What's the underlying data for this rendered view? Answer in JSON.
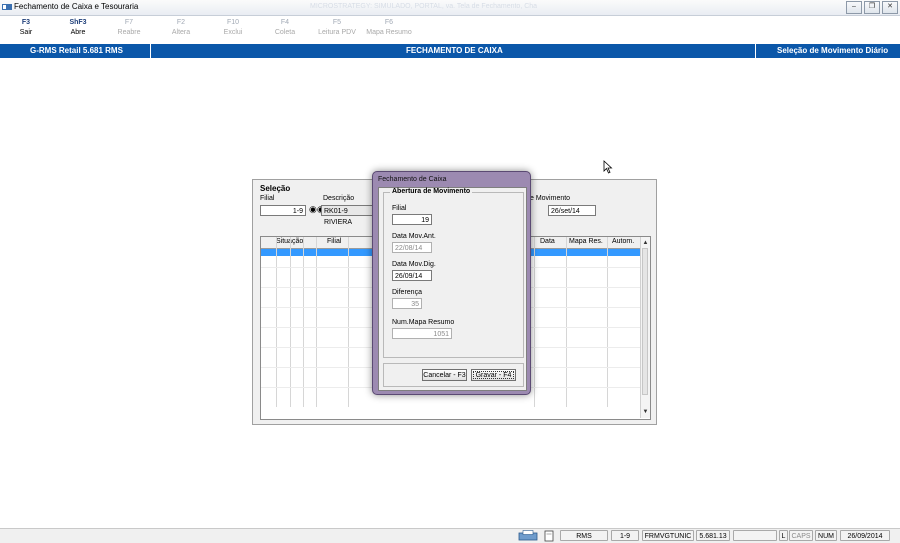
{
  "window": {
    "title": "Fechamento de Caixa e Tesouraria",
    "faded_title": "MICROSTRATEGY: SIMULADO, PORTAL, va. Tela de Fechamento, Cha"
  },
  "toolbar": {
    "keys": [
      {
        "key": "F3",
        "label": "Sair",
        "enabled": true
      },
      {
        "key": "ShF3",
        "label": "Abre",
        "enabled": true
      },
      {
        "key": "F7",
        "label": "Reabre",
        "enabled": false
      },
      {
        "key": "F2",
        "label": "Altera",
        "enabled": false
      },
      {
        "key": "F10",
        "label": "Exclui",
        "enabled": false
      },
      {
        "key": "F4",
        "label": "Coleta",
        "enabled": false
      },
      {
        "key": "F5",
        "label": "Leitura PDV",
        "enabled": false
      },
      {
        "key": "F6",
        "label": "Mapa Resumo",
        "enabled": false
      }
    ]
  },
  "header": {
    "system": "G-RMS Retail 5.681 RMS",
    "screen": "FECHAMENTO DE CAIXA",
    "mode": "Seleção de Movimento Diário"
  },
  "selection": {
    "title": "Seleção",
    "filial_label": "Filial",
    "filial_value": "1-9",
    "descricao_label": "Descrição",
    "descricao_value": "RK01-9 RIVIERA",
    "movimento_label": "e Movimento",
    "movimento_value": "26/set/14"
  },
  "grid": {
    "columns": [
      "Situação",
      "Filial",
      "Data",
      "Mapa Res.",
      "Autom."
    ]
  },
  "dialog": {
    "title": "Fechamento de Caixa",
    "group_title": "Abertura de Movimento",
    "fields": [
      {
        "label": "Filial",
        "value": "19",
        "enabled": true
      },
      {
        "label": "Data Mov.Ant.",
        "value": "22/08/14",
        "enabled": false
      },
      {
        "label": "Data Mov.Dig.",
        "value": "26/09/14",
        "enabled": true
      },
      {
        "label": "Diferença",
        "value": "35",
        "enabled": false
      },
      {
        "label": "Num.Mapa Resumo",
        "value": "1051",
        "enabled": false
      }
    ],
    "cancel_label": "Cancelar - F3",
    "save_label": "Gravar - F4"
  },
  "status": {
    "app": "RMS",
    "filial": "1-9",
    "program": "FRMVGTUNIC",
    "version": "5.681.13",
    "l": "L",
    "caps": "CAPS",
    "num": "NUM",
    "date": "26/09/2014"
  }
}
